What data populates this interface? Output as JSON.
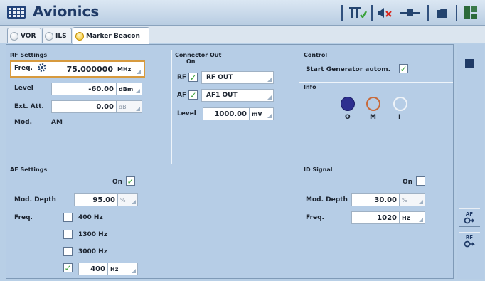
{
  "app": {
    "title": "Avionics"
  },
  "tabs": [
    {
      "label": "VOR",
      "selected": false
    },
    {
      "label": "ILS",
      "selected": false
    },
    {
      "label": "Marker Beacon",
      "selected": true
    }
  ],
  "rf_settings": {
    "title": "RF Settings",
    "freq_label": "Freq.",
    "freq_value": "75.000000",
    "freq_unit": "MHz",
    "level_label": "Level",
    "level_value": "-60.00",
    "level_unit": "dBm",
    "ext_att_label": "Ext. Att.",
    "ext_att_value": "0.00",
    "ext_att_unit": "dB",
    "mod_label": "Mod.",
    "mod_value": "AM"
  },
  "connector_out": {
    "title": "Connector Out",
    "on_label": "On",
    "rf_label": "RF",
    "rf_checked": true,
    "rf_value": "RF OUT",
    "af_label": "AF",
    "af_checked": true,
    "af_value": "AF1 OUT",
    "level_label": "Level",
    "level_value": "1000.00",
    "level_unit": "mV"
  },
  "control": {
    "title": "Control",
    "start_label": "Start Generator autom.",
    "start_checked": true
  },
  "info": {
    "title": "Info",
    "markers": [
      {
        "label": "O",
        "color": "#2e2f8f",
        "filled": true
      },
      {
        "label": "M",
        "color": "#c86a3a",
        "filled": false
      },
      {
        "label": "I",
        "color": "#ffffff",
        "filled": false
      }
    ]
  },
  "af_settings": {
    "title": "AF Settings",
    "on_label": "On",
    "on_checked": true,
    "mod_depth_label": "Mod. Depth",
    "mod_depth_value": "95.00",
    "mod_depth_unit": "%",
    "freq_label": "Freq.",
    "freq_options": [
      {
        "label": "400 Hz",
        "checked": false
      },
      {
        "label": "1300 Hz",
        "checked": false
      },
      {
        "label": "3000 Hz",
        "checked": false
      }
    ],
    "custom_checked": true,
    "custom_value": "400",
    "custom_unit": "Hz"
  },
  "id_signal": {
    "title": "ID Signal",
    "on_label": "On",
    "on_checked": false,
    "mod_depth_label": "Mod. Depth",
    "mod_depth_value": "30.00",
    "mod_depth_unit": "%",
    "freq_label": "Freq.",
    "freq_value": "1020",
    "freq_unit": "Hz"
  },
  "side": {
    "af_label": "AF",
    "rf_label": "RF"
  },
  "colors": {
    "panel": "#b6cde6",
    "title_text": "#1f3a66",
    "check_green": "#3aa23a",
    "highlight_border": "#d79a3e"
  }
}
